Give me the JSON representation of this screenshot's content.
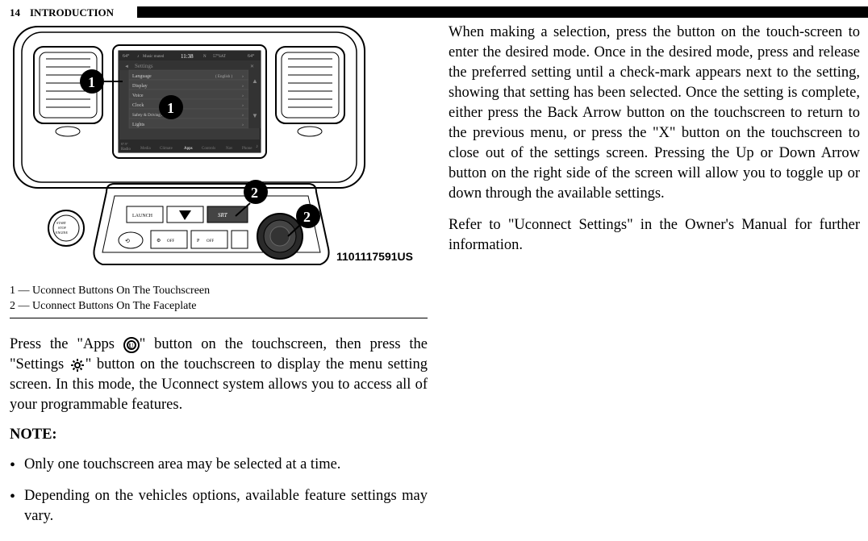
{
  "header": {
    "page_number": "14",
    "section_title": "INTRODUCTION"
  },
  "diagram": {
    "image_id": "1101117591US",
    "callouts": [
      "1",
      "1",
      "2",
      "2"
    ],
    "screen_items": {
      "top_left": "64°",
      "top_right": "64°",
      "music_status": "Music muted",
      "time": "11:38",
      "direction": "N",
      "sat_info": "57°SAT",
      "settings_title": "Settings",
      "menu_items": [
        "Language",
        "Display",
        "Voice",
        "Clock",
        "Safety & Driving Assistance",
        "Lights"
      ],
      "language_value": "( English )",
      "bottom_left": "Radio",
      "bottom_tabs": [
        "Media",
        "Climate",
        "Apps",
        "Controls",
        "Nav",
        "Phone"
      ],
      "temp_display": "87.9°"
    },
    "faceplate": {
      "start_button": "START STOP ENGINE",
      "launch": "LAUNCH",
      "srt": "SRT",
      "off": "OFF",
      "p_off": "P OFF"
    }
  },
  "legend": {
    "item1": "1 — Uconnect Buttons On The Touchscreen",
    "item2": "2 — Uconnect Buttons On The Faceplate"
  },
  "left_text": {
    "para1_part1": "Press the \"Apps ",
    "para1_part2": "\" button on the touchscreen, then press the \"Settings ",
    "para1_part3": "\" button on the touchscreen to display the menu setting screen. In this mode, the Uconnect system allows you to access all of your programmable features.",
    "note_heading": "NOTE:",
    "bullet1": "Only one touchscreen area may be selected at a time.",
    "bullet2": "Depending on the vehicles options, available feature settings may vary."
  },
  "right_text": {
    "para1": "When making a selection, press the button on the touch-screen to enter the desired mode. Once in the desired mode, press and release the preferred setting until a check-mark appears next to the setting, showing that setting has been selected. Once the setting is complete, either press the Back Arrow button on the touchscreen to return to the previous menu, or press the \"X\" button on the touchscreen to close out of the settings screen. Pressing the Up or Down Arrow button on the right side of the screen will allow you to toggle up or down through the available settings.",
    "para2": "Refer to \"Uconnect Settings\" in the Owner's Manual for further information."
  }
}
